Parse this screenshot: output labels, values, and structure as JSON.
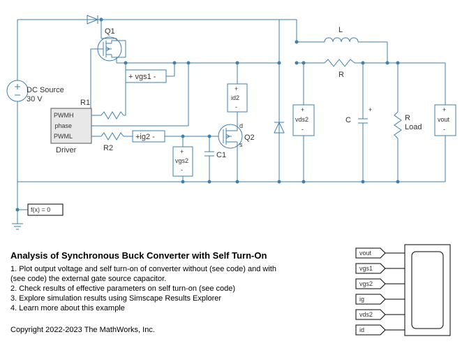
{
  "components": {
    "q1": "Q1",
    "q2": "Q2",
    "l": "L",
    "r": "R",
    "r1": "R1",
    "r2": "R2",
    "c": "C",
    "c1": "C1",
    "rload_a": "R",
    "rload_b": "Load",
    "dc_a": "DC Source",
    "dc_b": "30 V",
    "driver": "Driver",
    "pwmh": "PWMH",
    "pwml": "PWML",
    "phase": "phase",
    "vgs1": "+ vgs1  -",
    "vgs2_a": "+",
    "vgs2_b": "vgs2",
    "vgs2_c": "-",
    "ig2": "+ig2  -",
    "id2_a": "+",
    "id2_b": "id2",
    "id2_c": "-",
    "vds2_a": "+",
    "vds2_b": "vds2",
    "vds2_c": "-",
    "vout_a": "+",
    "vout_b": "vout",
    "vout_c": "-",
    "fx0": "f(x) = 0",
    "mos_d": "d",
    "mos_s": "s"
  },
  "tags": [
    "vout",
    "vgs1",
    "vgs2",
    "ig",
    "vds2",
    "id"
  ],
  "title": "Analysis of Synchronous Buck Converter with Self Turn-On",
  "steps": [
    "1. Plot output voltage and self turn-on of converter without (see code) and with",
    "(see code) the external gate source capacitor.",
    "2. Check results of effective parameters on self turn-on (see code)",
    "3. Explore simulation results using Simscape Results Explorer",
    "4. Learn more about this example"
  ],
  "copyright": "Copyright 2022-2023 The MathWorks, Inc."
}
